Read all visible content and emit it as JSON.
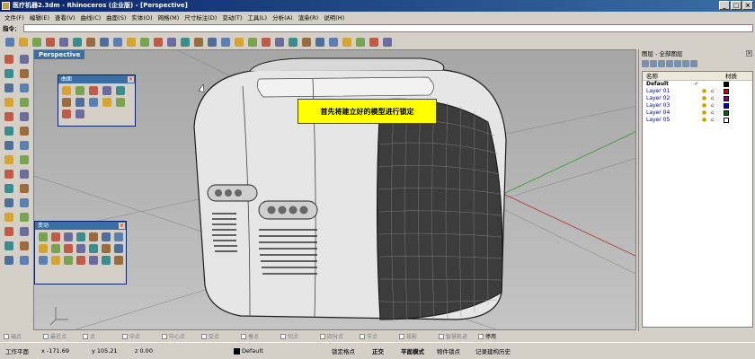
{
  "window": {
    "title": "医疗机器2.3dm - Rhinoceros (企业版) - [Perspective]",
    "min": "_",
    "max": "□",
    "close": "×"
  },
  "menu": [
    "文件(F)",
    "编辑(E)",
    "查看(V)",
    "曲线(C)",
    "曲面(S)",
    "实体(O)",
    "网格(M)",
    "尺寸标注(D)",
    "变动(T)",
    "工具(L)",
    "分析(A)",
    "渲染(R)",
    "说明(H)"
  ],
  "command": {
    "label": "指令：",
    "value": ""
  },
  "toolbar_icons": [
    "new-icon",
    "open-icon",
    "save-icon",
    "print-icon",
    "import-icon",
    "cut-icon",
    "copy-icon",
    "paste-icon",
    "undo-icon",
    "redo-icon",
    "pan-icon",
    "rotate-view-icon",
    "zoom-icon",
    "zoom-window-icon",
    "zoom-extents-icon",
    "zoom-selected-icon",
    "four-viewports-icon",
    "grid-icon",
    "select-icon",
    "object-properties-icon",
    "layer-icon",
    "light-icon",
    "shade-icon",
    "render-icon",
    "color-wheel-icon",
    "texture-icon",
    "options-icon",
    "plugin-icon",
    "help-icon"
  ],
  "left_toolbar_icons": [
    "select-point-icon",
    "point-icon",
    "polyline-icon",
    "curve-icon",
    "circle-icon",
    "arc-icon",
    "ellipse-icon",
    "rectangle-icon",
    "polygon-icon",
    "fillet-curve-icon",
    "surface-icon",
    "extrude-icon",
    "solid-box-icon",
    "sphere-icon",
    "boolean-union-icon",
    "mesh-icon",
    "dimension-icon",
    "text-icon",
    "transform-icon",
    "array-icon",
    "trim-icon",
    "split-icon",
    "join-icon",
    "explode-icon",
    "group-icon",
    "analyze-icon",
    "render-icon",
    "material-icon",
    "block-icon",
    "camera-icon"
  ],
  "viewport": {
    "name": "Perspective"
  },
  "panel_surface": {
    "title": "曲面",
    "icons": [
      "surface-corner-icon",
      "surface-edge-icon",
      "surface-plane-icon",
      "extrude-icon",
      "loft-icon",
      "revolve-icon",
      "sweep1-icon",
      "sweep2-icon",
      "network-icon",
      "patch-icon",
      "blend-icon",
      "mesh-surface-icon"
    ]
  },
  "panel_transform": {
    "title": "变动",
    "icons": [
      "move-icon",
      "copy-icon",
      "rotate-icon",
      "scale-icon",
      "mirror-icon",
      "orient-icon",
      "array-icon",
      "align-icon",
      "twist-icon",
      "bend-icon",
      "taper-icon",
      "flow-icon",
      "project-icon",
      "flatten-icon",
      "smooth-icon",
      "cage-icon",
      "splop-icon",
      "shear-icon",
      "stretch-icon",
      "maelstrom-icon",
      "set-points-icon"
    ]
  },
  "callout": "首先将建立好的模型进行锁定",
  "osnaps": [
    {
      "label": "端点",
      "on": false
    },
    {
      "label": "最近点",
      "on": false
    },
    {
      "label": "点",
      "on": false
    },
    {
      "label": "中点",
      "on": false
    },
    {
      "label": "中心点",
      "on": false
    },
    {
      "label": "交点",
      "on": false
    },
    {
      "label": "垂点",
      "on": false
    },
    {
      "label": "切点",
      "on": false
    },
    {
      "label": "四分点",
      "on": false
    },
    {
      "label": "节点",
      "on": false
    },
    {
      "label": "投影",
      "on": false
    },
    {
      "label": "智慧轨迹",
      "on": false
    },
    {
      "label": "停用",
      "on": true
    }
  ],
  "layers": {
    "title": "图层 - 全部图层",
    "close": "×",
    "col_name": "名称",
    "col_material": "材质",
    "rows": [
      {
        "name": "Default",
        "current": "✓",
        "color": "#000000",
        "default": true
      },
      {
        "name": "Layer 01",
        "current": "",
        "color": "#cc0000",
        "default": false
      },
      {
        "name": "Layer 02",
        "current": "",
        "color": "#800080",
        "default": false
      },
      {
        "name": "Layer 03",
        "current": "",
        "color": "#0000cc",
        "default": false
      },
      {
        "name": "Layer 04",
        "current": "",
        "color": "#006400",
        "default": false
      },
      {
        "name": "Layer 05",
        "current": "",
        "color": "#ffffff",
        "default": false
      }
    ]
  },
  "status": {
    "cplane": "工作平面",
    "x": "x -171.69",
    "y": "y 105.21",
    "z": "z 0.00",
    "layer": "Default",
    "grid_snap": "锁定格点",
    "ortho": "正交",
    "planar": "平面模式",
    "osnap": "物件锁点",
    "history": "记录建构历史"
  },
  "colors": {
    "title_bar": "#0a246a",
    "viewport_tab": "#3a6ea5",
    "callout": "#ffff00",
    "grid_green": "#2e9e2e",
    "grid_red": "#b03030"
  }
}
